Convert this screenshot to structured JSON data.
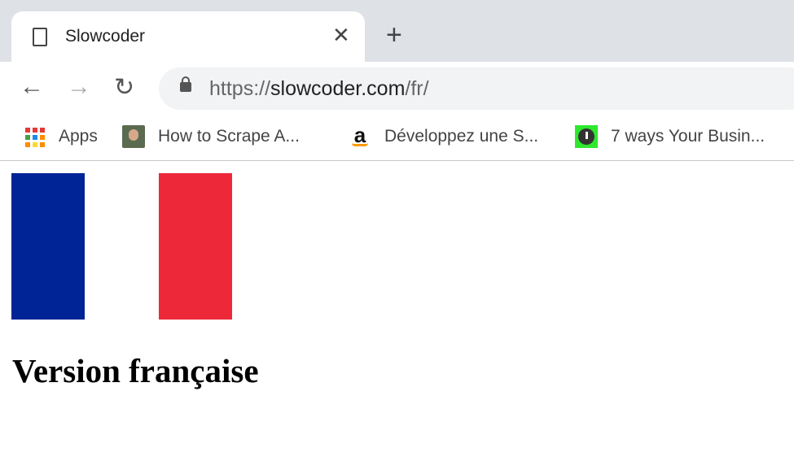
{
  "tab": {
    "title": "Slowcoder",
    "icon": "document-icon",
    "close_icon": "close-icon"
  },
  "new_tab_icon": "plus-icon",
  "url": {
    "scheme": "https://",
    "host": "slowcoder.com",
    "path": "/fr/"
  },
  "bookmarks": [
    {
      "label": "Apps",
      "icon": "apps-grid-icon"
    },
    {
      "label": "How to Scrape A...",
      "icon": "person-avatar-icon"
    },
    {
      "label": "Développez une S...",
      "icon": "amazon-icon"
    },
    {
      "label": "7 ways Your Busin...",
      "icon": "watch-icon"
    }
  ],
  "flag": {
    "colors": [
      "#002395",
      "#ffffff",
      "#ed2939"
    ]
  },
  "page": {
    "heading": "Version française"
  }
}
